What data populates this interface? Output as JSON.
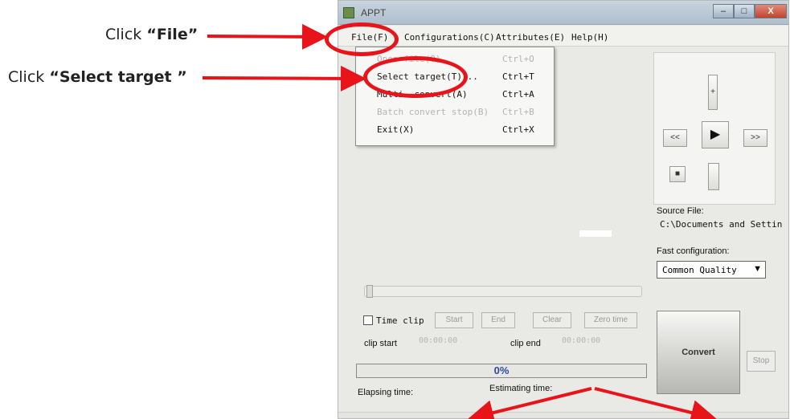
{
  "annotations": {
    "click_file": {
      "prefix": "Click ",
      "bold": "“File”"
    },
    "click_select": {
      "prefix": "Click ",
      "bold": "“Select target ”"
    }
  },
  "window": {
    "title": "APPT",
    "controls": {
      "minimize": "–",
      "maximize": "□",
      "close": "X"
    }
  },
  "menubar": {
    "items": [
      {
        "label": "File(F)"
      },
      {
        "label": "Configurations(C)"
      },
      {
        "label": "Attributes(E)"
      },
      {
        "label": "Help(H)"
      }
    ]
  },
  "file_menu": {
    "items": [
      {
        "label": "Open file(O)",
        "shortcut": "Ctrl+O",
        "disabled": true
      },
      {
        "label": "Select target(T)...",
        "shortcut": "Ctrl+T",
        "disabled": false
      },
      {
        "label": "Multi. convert(A)",
        "shortcut": "Ctrl+A",
        "disabled": false
      },
      {
        "label": "Batch convert stop(B)",
        "shortcut": "Ctrl+B",
        "disabled": true
      },
      {
        "label": "Exit(X)",
        "shortcut": "Ctrl+X",
        "disabled": false
      }
    ]
  },
  "player": {
    "rewind": "<<",
    "play": "▶",
    "forward": ">>",
    "stop": "■",
    "volume": "+"
  },
  "source": {
    "label": "Source File:",
    "path": "C:\\Documents and Settin"
  },
  "fast_config": {
    "label": "Fast configuration:",
    "selected": "Common Quality",
    "arrow": "▼"
  },
  "clip": {
    "checkbox_label": "Time clip",
    "start_btn": "Start",
    "end_btn": "End",
    "clear_btn": "Clear",
    "zero_btn": "Zero time",
    "clip_start_label": "clip start",
    "clip_start_value": "00:00:00",
    "clip_end_label": "clip end",
    "clip_end_value": "00:00:00"
  },
  "progress": {
    "percent_text": "0%",
    "value": 0
  },
  "status": {
    "elapsed_label": "Elapsing time:",
    "remaining_label": "Estimating time:"
  },
  "convert": {
    "label": "Convert",
    "stop": "Stop"
  },
  "colors": {
    "annotation_red": "#e8141a",
    "progress_text": "#2c4aa0"
  }
}
